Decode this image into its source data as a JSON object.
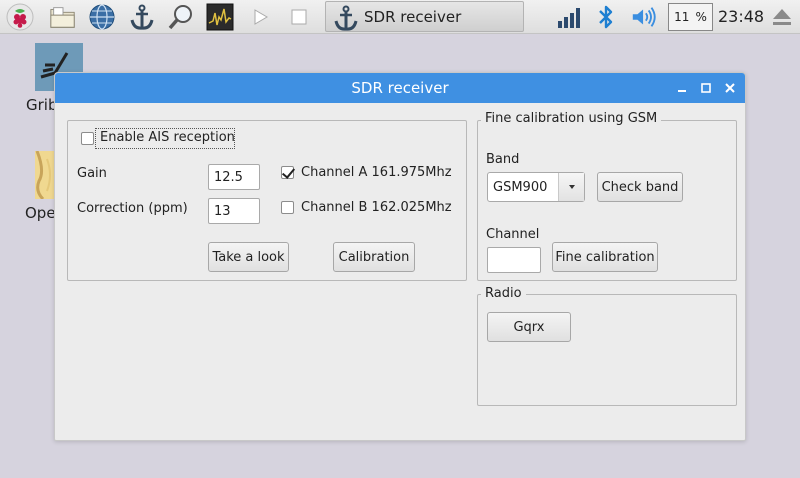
{
  "taskbar": {
    "launchers": [
      "raspberry-menu-icon",
      "file-manager-icon",
      "web-browser-icon",
      "anchor-app-icon",
      "search-icon",
      "system-monitor-icon",
      "play-icon",
      "stop-icon"
    ],
    "task_title": "SDR receiver",
    "cpu_value": "11",
    "cpu_unit": "%",
    "clock": "23:48",
    "tray": [
      "network-signal-icon",
      "bluetooth-icon",
      "volume-icon",
      "eject-icon"
    ]
  },
  "desktop": {
    "icons": [
      {
        "label": "Grib",
        "icon": "grib-app-icon"
      },
      {
        "label": "Ope",
        "icon": "opencpn-map-icon"
      }
    ]
  },
  "window": {
    "title": "SDR receiver",
    "controls": [
      "minimize-icon",
      "maximize-icon",
      "close-icon"
    ],
    "ais": {
      "enable_label": "Enable AIS reception",
      "enable_checked": false,
      "gain_label": "Gain",
      "gain_value": "12.5",
      "correction_label": "Correction (ppm)",
      "correction_value": "13",
      "channel_a_label": "Channel A 161.975Mhz",
      "channel_a_checked": true,
      "channel_b_label": "Channel B 162.025Mhz",
      "channel_b_checked": false,
      "take_look_label": "Take a look",
      "calibration_label": "Calibration"
    },
    "gsm": {
      "group_title": "Fine calibration using GSM",
      "band_label": "Band",
      "band_value": "GSM900",
      "check_band_label": "Check band",
      "channel_label": "Channel",
      "channel_value": "",
      "fine_calibration_label": "Fine calibration"
    },
    "radio": {
      "group_title": "Radio",
      "gqrx_label": "Gqrx"
    }
  },
  "colors": {
    "titlebar": "#3f90e2",
    "desktop": "#d6d3de",
    "window_bg": "#ececec"
  }
}
